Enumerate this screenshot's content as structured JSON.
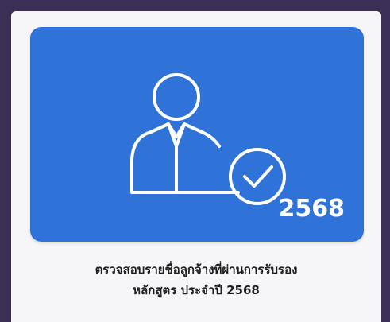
{
  "card": {
    "year": "2568",
    "icon": "user-check-icon",
    "color": "#2f72d8"
  },
  "caption": {
    "line1": "ตรวจสอบรายชื่อลูกจ้างที่ผ่านการรับรอง",
    "line2": "หลักสูตร ประจำปี 2568"
  }
}
